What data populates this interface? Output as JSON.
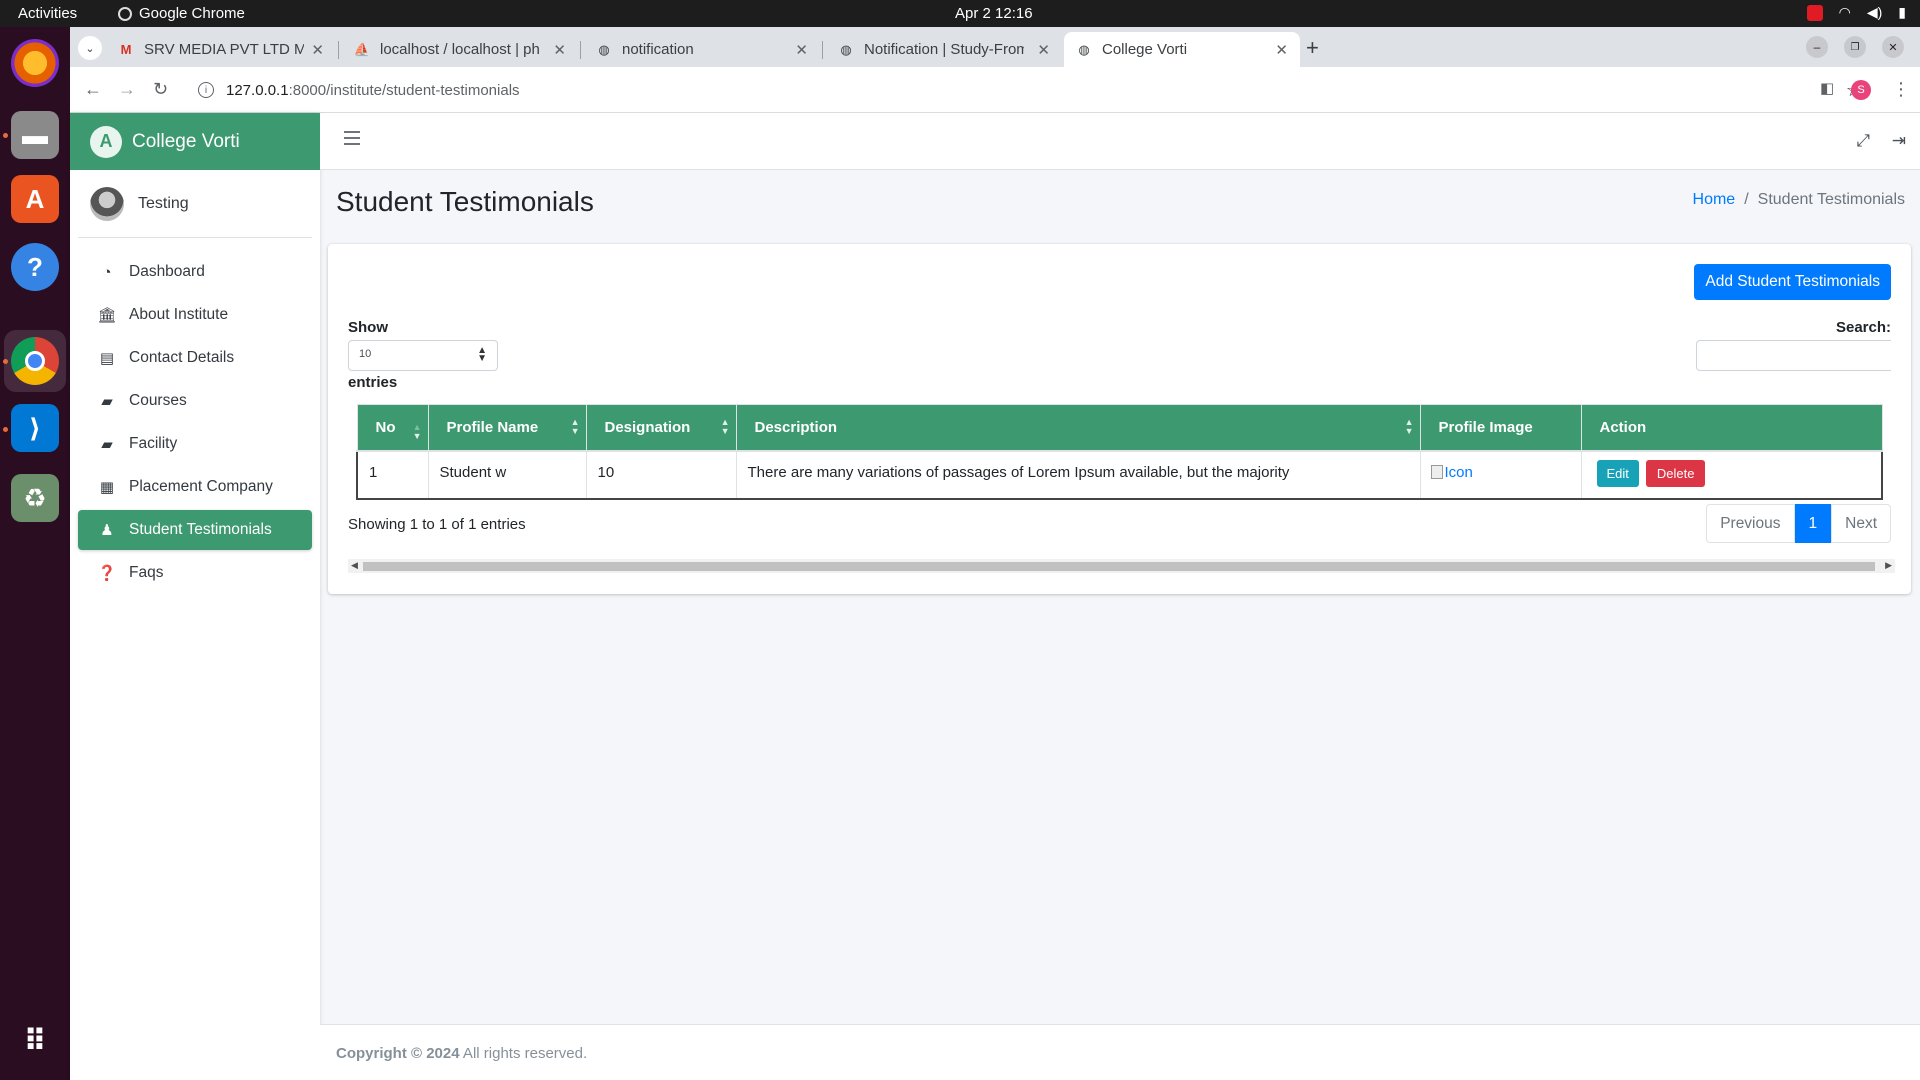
{
  "os": {
    "activities": "Activities",
    "app_name": "Google Chrome",
    "clock": "Apr 2  12:16"
  },
  "browser": {
    "tabs": [
      {
        "title": "SRV MEDIA PVT LTD Mail",
        "favicon": "gmail-icon"
      },
      {
        "title": "localhost / localhost | phpMyAdmin",
        "favicon": "phpmyadmin-icon"
      },
      {
        "title": "notification",
        "favicon": "globe-icon"
      },
      {
        "title": "Notification | Study-From",
        "favicon": "globe-icon"
      },
      {
        "title": "College Vorti",
        "favicon": "globe-icon"
      }
    ],
    "url_host": "127.0.0.1",
    "url_path": ":8000/institute/student-testimonials",
    "profile_initial": "S"
  },
  "sidebar": {
    "brand": "College Vorti",
    "brand_logo": "A",
    "user_name": "Testing",
    "items": [
      {
        "label": "Dashboard",
        "icon": "tachometer-icon"
      },
      {
        "label": "About Institute",
        "icon": "university-icon"
      },
      {
        "label": "Contact Details",
        "icon": "address-book-icon"
      },
      {
        "label": "Courses",
        "icon": "book-icon"
      },
      {
        "label": "Facility",
        "icon": "book-open-icon"
      },
      {
        "label": "Placement Company",
        "icon": "building-icon"
      },
      {
        "label": "Student Testimonials",
        "icon": "user-graduate-icon"
      },
      {
        "label": "Faqs",
        "icon": "question-circle-icon"
      }
    ]
  },
  "page": {
    "title": "Student Testimonials",
    "breadcrumb_home": "Home",
    "breadcrumb_current": "Student Testimonials",
    "add_button": "Add Student Testimonials",
    "show_label": "Show",
    "length_value": "10",
    "entries_label": "entries",
    "search_label": "Search:",
    "search_value": ""
  },
  "table": {
    "headers": [
      "No",
      "Profile Name",
      "Designation",
      "Description",
      "Profile Image",
      "Action"
    ],
    "rows": [
      {
        "no": "1",
        "profile_name": "Student w",
        "designation": "10",
        "description": "There are many variations of passages of Lorem Ipsum available, but the majority",
        "image_alt": "Icon",
        "edit": "Edit",
        "delete": "Delete"
      }
    ],
    "info": "Showing 1 to 1 of 1 entries",
    "pager": {
      "prev": "Previous",
      "current": "1",
      "next": "Next"
    }
  },
  "footer": {
    "copyright": "Copyright © 2024",
    "rights": " All rights reserved."
  },
  "colors": {
    "primary": "#3d9970",
    "link": "#007bff",
    "edit": "#17a2b8",
    "delete": "#dc3545"
  }
}
